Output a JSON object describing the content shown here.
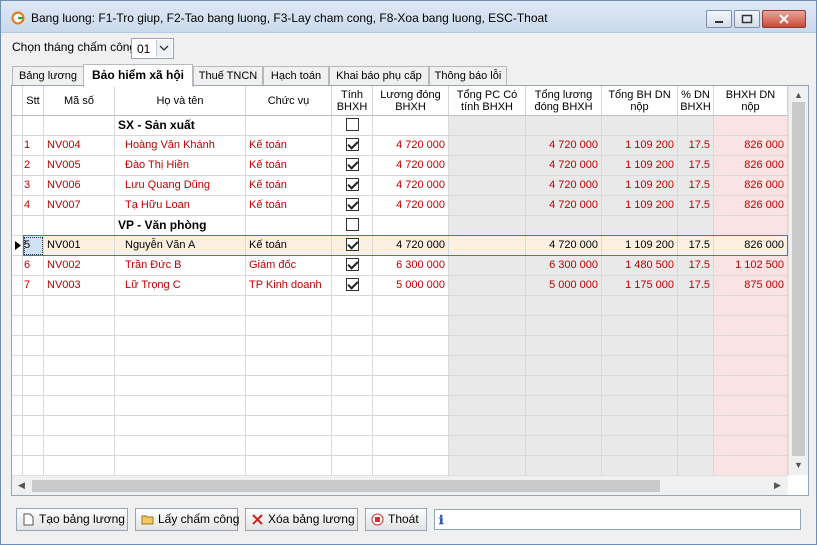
{
  "window": {
    "title": "Bang luong: F1-Tro giup, F2-Tao bang luong, F3-Lay cham cong, F8-Xoa bang luong, ESC-Thoat"
  },
  "month_selector": {
    "label": "Chọn tháng chấm công:",
    "value": "01"
  },
  "tabs": [
    {
      "label": "Bảng lương"
    },
    {
      "label": "Bảo hiểm xã hội"
    },
    {
      "label": "Thuế TNCN"
    },
    {
      "label": "Hạch toán"
    },
    {
      "label": "Khai báo phụ cấp"
    },
    {
      "label": "Thông báo lỗi"
    }
  ],
  "columns": [
    {
      "label": "Stt"
    },
    {
      "label": "Mã số"
    },
    {
      "label": "Họ và tên"
    },
    {
      "label": "Chức vụ"
    },
    {
      "label": "Tính BHXH"
    },
    {
      "label": "Lương đóng BHXH"
    },
    {
      "label": "Tổng PC Có tính BHXH"
    },
    {
      "label": "Tổng lương đóng BHXH"
    },
    {
      "label": "Tổng BH DN nộp"
    },
    {
      "label": "% DN BHXH"
    },
    {
      "label": "BHXH DN nộp"
    }
  ],
  "rows": [
    {
      "kind": "group",
      "label": "SX - Sản xuất",
      "checked": false
    },
    {
      "kind": "data",
      "stt": "1",
      "code": "NV004",
      "name": "Hoàng Văn Khánh",
      "position": "Kế toán",
      "checked": true,
      "salary": "4 720 000",
      "allowance": "",
      "total_salary": "4 720 000",
      "total_bh": "1 109 200",
      "pct": "17.5",
      "bhxh": "826 000",
      "red": true
    },
    {
      "kind": "data",
      "stt": "2",
      "code": "NV005",
      "name": "Đào Thị Hiền",
      "position": "Kế toán",
      "checked": true,
      "salary": "4 720 000",
      "allowance": "",
      "total_salary": "4 720 000",
      "total_bh": "1 109 200",
      "pct": "17.5",
      "bhxh": "826 000",
      "red": true
    },
    {
      "kind": "data",
      "stt": "3",
      "code": "NV006",
      "name": "Lưu Quang Dũng",
      "position": "Kế toán",
      "checked": true,
      "salary": "4 720 000",
      "allowance": "",
      "total_salary": "4 720 000",
      "total_bh": "1 109 200",
      "pct": "17.5",
      "bhxh": "826 000",
      "red": true
    },
    {
      "kind": "data",
      "stt": "4",
      "code": "NV007",
      "name": "Tạ Hữu Loan",
      "position": "Kế toán",
      "checked": true,
      "salary": "4 720 000",
      "allowance": "",
      "total_salary": "4 720 000",
      "total_bh": "1 109 200",
      "pct": "17.5",
      "bhxh": "826 000",
      "red": true
    },
    {
      "kind": "group",
      "label": "VP - Văn phòng",
      "checked": false
    },
    {
      "kind": "data",
      "stt": "5",
      "code": "NV001",
      "name": "Nguyễn Văn A",
      "position": "Kế toán",
      "checked": true,
      "salary": "4 720 000",
      "allowance": "",
      "total_salary": "4 720 000",
      "total_bh": "1 109 200",
      "pct": "17.5",
      "bhxh": "826 000",
      "red": false,
      "selected": true
    },
    {
      "kind": "data",
      "stt": "6",
      "code": "NV002",
      "name": "Trần Đức B",
      "position": "Giám đốc",
      "checked": true,
      "salary": "6 300 000",
      "allowance": "",
      "total_salary": "6 300 000",
      "total_bh": "1 480 500",
      "pct": "17.5",
      "bhxh": "1 102 500",
      "red": true
    },
    {
      "kind": "data",
      "stt": "7",
      "code": "NV003",
      "name": "Lữ Trọng C",
      "position": "TP Kinh doanh",
      "checked": true,
      "salary": "5 000 000",
      "allowance": "",
      "total_salary": "5 000 000",
      "total_bh": "1 175 000",
      "pct": "17.5",
      "bhxh": "875 000",
      "red": true
    }
  ],
  "buttons": {
    "create": "Tạo bảng lương",
    "fetch": "Lấy chấm công",
    "delete": "Xóa bảng lương",
    "exit": "Thoát"
  },
  "info": {
    "text": ""
  },
  "colors": {
    "red_text": "#c00000",
    "selected_row": "#fdf0e3",
    "highlight_col": "#fbe3e3",
    "gray_col": "#e9e9e9"
  }
}
